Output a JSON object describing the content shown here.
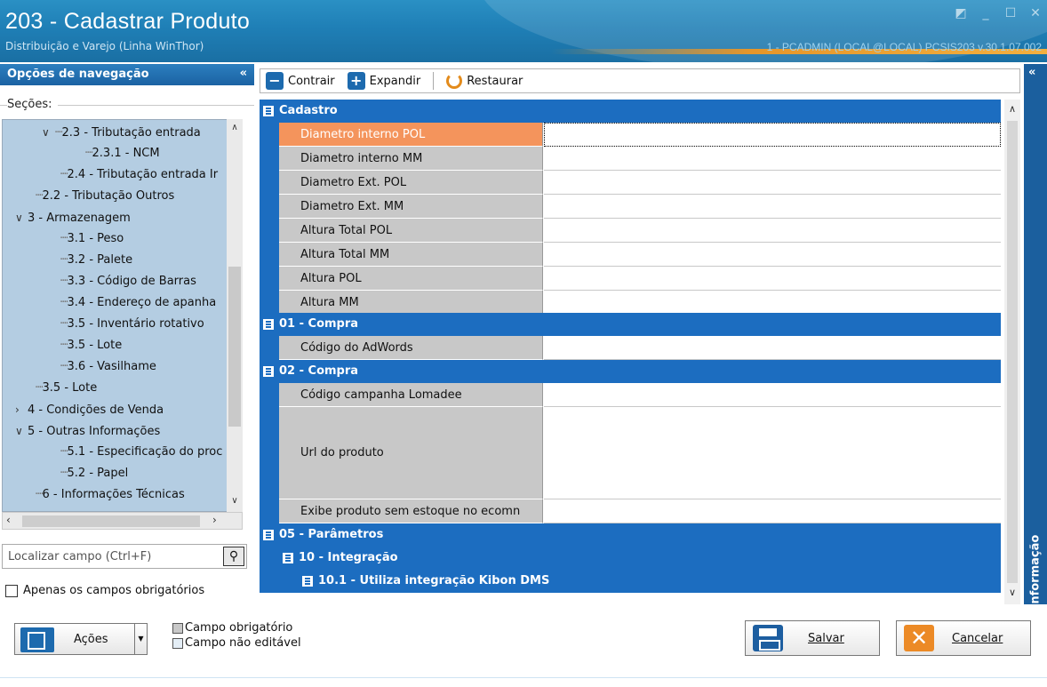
{
  "window": {
    "title": "203 - Cadastrar  Produto",
    "subtitle": "Distribuição e Varejo (Linha WinThor)",
    "info": "1 - PCADMIN (LOCAL@LOCAL)   PCSIS203  v.30.1.07.002"
  },
  "nav": {
    "header": "Opções de navegação",
    "collapse": "«",
    "sections_label": "Seções:",
    "tree": [
      {
        "label": "2.3 - Tributação entrada",
        "chevron": "∨"
      },
      {
        "label": "2.3.1 - NCM",
        "chevron": ""
      },
      {
        "label": "2.4 - Tributação entrada Ir",
        "chevron": ""
      },
      {
        "label": "2.2 - Tributação Outros",
        "chevron": ""
      },
      {
        "label": "3 - Armazenagem",
        "chevron": "∨"
      },
      {
        "label": "3.1 - Peso",
        "chevron": ""
      },
      {
        "label": "3.2 - Palete",
        "chevron": ""
      },
      {
        "label": "3.3 - Código de Barras",
        "chevron": ""
      },
      {
        "label": "3.4 - Endereço de apanha",
        "chevron": ""
      },
      {
        "label": "3.5 - Inventário rotativo",
        "chevron": ""
      },
      {
        "label": "3.5 - Lote",
        "chevron": ""
      },
      {
        "label": "3.6 - Vasilhame",
        "chevron": ""
      },
      {
        "label": "3.5 - Lote",
        "chevron": ""
      },
      {
        "label": "4 - Condições de Venda",
        "chevron": "›"
      },
      {
        "label": "5 - Outras Informações",
        "chevron": "∨"
      },
      {
        "label": "5.1 - Especificação do proc",
        "chevron": ""
      },
      {
        "label": "5.2 - Papel",
        "chevron": ""
      },
      {
        "label": "6 - Informações Técnicas",
        "chevron": ""
      }
    ],
    "search_placeholder": "Localizar campo (Ctrl+F)",
    "only_required": "Apenas os campos obrigatórios"
  },
  "toolbar": {
    "collapse": "Contrair",
    "expand": "Expandir",
    "restore": "Restaurar"
  },
  "grid": {
    "cat_cadastro": "Cadastro",
    "cadastro_rows": [
      "Diametro interno POL",
      "Diametro interno MM",
      "Diametro Ext. POL",
      "Diametro Ext. MM",
      "Altura Total POL",
      "Altura Total MM",
      "Altura POL",
      "Altura MM"
    ],
    "cat_compra1": "01 - Compra",
    "compra1_rows": [
      "Código do AdWords"
    ],
    "cat_compra2": "02 - Compra",
    "compra2_rows": [
      "Código campanha Lomadee",
      "Url do produto",
      "Exibe produto sem estoque no ecomn"
    ],
    "cat_param": "05 - Parâmetros",
    "cat_integ": "10 - Integração",
    "cat_kibon": "10.1 - Utiliza integração Kibon DMS"
  },
  "right_rail": {
    "collapse": "«",
    "label": "Informação"
  },
  "bottom": {
    "actions": "Ações",
    "legend_required": "Campo obrigatório",
    "legend_readonly": "Campo não editável",
    "save": "Salvar",
    "cancel": "Cancelar"
  },
  "colors": {
    "accent": "#1c6dc0",
    "selected_row": "#f4945c",
    "tree_bg": "#b4cde2"
  }
}
